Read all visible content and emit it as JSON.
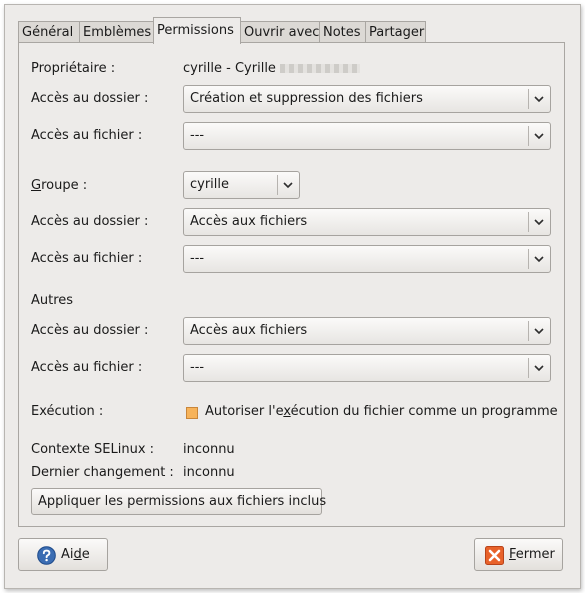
{
  "tabs": [
    "Général",
    "Emblèmes",
    "Permissions",
    "Ouvrir avec",
    "Notes",
    "Partager"
  ],
  "owner": {
    "label": "Propriétaire :",
    "value": "cyrille - Cyrille"
  },
  "owner_perms": {
    "folder_label": "Accès au dossier :",
    "folder_value": "Création et suppression des fichiers",
    "file_label": "Accès au fichier :",
    "file_value": "---"
  },
  "group": {
    "label_prefix": "G",
    "label_rest": "roupe :",
    "value": "cyrille",
    "folder_label": "Accès au dossier :",
    "folder_value": "Accès aux fichiers",
    "file_label": "Accès au fichier :",
    "file_value": "---"
  },
  "others": {
    "heading": "Autres",
    "folder_label": "Accès au dossier :",
    "folder_value": "Accès aux fichiers",
    "file_label": "Accès au fichier :",
    "file_value": "---"
  },
  "execution": {
    "label": "Exécution :",
    "checkbox_pre": "Autoriser l'e",
    "checkbox_mnemonic": "x",
    "checkbox_post": "écution du fichier comme un programme",
    "checked_color": "#f7b35a"
  },
  "selinux": {
    "label": "Contexte SELinux :",
    "value": "inconnu"
  },
  "last_change": {
    "label": "Dernier changement :",
    "value": "inconnu"
  },
  "apply_button": "Appliquer les permissions aux fichiers inclus",
  "help_button": {
    "pre": "Ai",
    "mnemonic": "d",
    "post": "e"
  },
  "close_button": {
    "mnemonic": "F",
    "post": "ermer"
  },
  "icons": {
    "help": "help-icon",
    "close": "close-icon",
    "dropdown": "chevron-down-icon"
  }
}
